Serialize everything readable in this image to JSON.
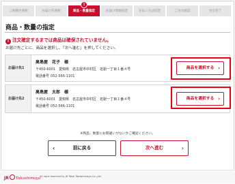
{
  "steps": [
    {
      "label": "ご依頼主選択"
    },
    {
      "label": "お届け先選択"
    },
    {
      "label": "商品・数量指定",
      "number": "3",
      "active": true
    },
    {
      "label": "お届け情報指定"
    },
    {
      "label": "支払い方法指定"
    },
    {
      "label": "ご注文確認"
    },
    {
      "label": "注文完了"
    }
  ],
  "page_title": "商品・数量の指定",
  "warning": {
    "mark": "!",
    "text": "注文確定するまでは商品は確保されていません。"
  },
  "instruction": "お届け先ごとに、商品を選択し、「次へ進む」を押してください。",
  "destinations": [
    {
      "label": "お届け先1",
      "name": "高島屋　花子　様",
      "address": "〒450-6001　愛知県　名古屋市中村区　名駅一丁目１番４号",
      "phone_label": "電話番号",
      "phone": "052-566-1101",
      "button_label": "商品を選択する",
      "button_chevron": "›"
    },
    {
      "label": "お届け先2",
      "name": "高島屋　太郎　様",
      "address": "〒450-6001　愛知県　名古屋市中村区　名駅一丁目１番４号",
      "phone_label": "電話番号",
      "phone": "052-566-1101",
      "button_label": "商品を選択する",
      "button_chevron": "›"
    }
  ],
  "note": "※商品、数量にお間違いがないかご確認ください。",
  "nav": {
    "prev_label": "前に戻る",
    "prev_chevron": "‹",
    "next_label": "次へ進む",
    "next_chevron": "›"
  },
  "footer": {
    "logo_left": "JR",
    "logo_brand": "Takashimaya",
    "copyright": "All right reserved by JR Tokai Takashimaya Co.,Ltd."
  },
  "colors": {
    "accent": "#c8102e",
    "highlight": "#e60012"
  }
}
